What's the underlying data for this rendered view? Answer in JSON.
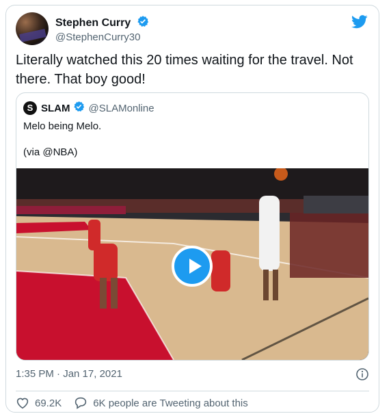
{
  "author": {
    "display_name": "Stephen Curry",
    "handle": "@StephenCurry30"
  },
  "tweet": {
    "text": "Literally watched this 20 times waiting for the travel. Not there. That boy good!"
  },
  "quoted": {
    "display_name": "SLAM",
    "avatar_letter": "S",
    "handle": "@SLAMonline",
    "text_line1": "Melo being Melo.",
    "text_line2": "(via @NBA)"
  },
  "meta": {
    "timestamp": "1:35 PM · Jan 17, 2021",
    "likes": "69.2K",
    "tweeting_about": "6K people are Tweeting about this"
  },
  "colors": {
    "accent": "#1d9bf0",
    "text": "#0f1419",
    "secondary": "#536471",
    "border": "#cfd9de",
    "court_red": "#c8102e",
    "court_wood": "#d9b98f"
  },
  "icons": [
    "verified-badge-icon",
    "twitter-bird-icon",
    "play-icon",
    "info-icon",
    "heart-icon",
    "speech-bubble-icon"
  ]
}
